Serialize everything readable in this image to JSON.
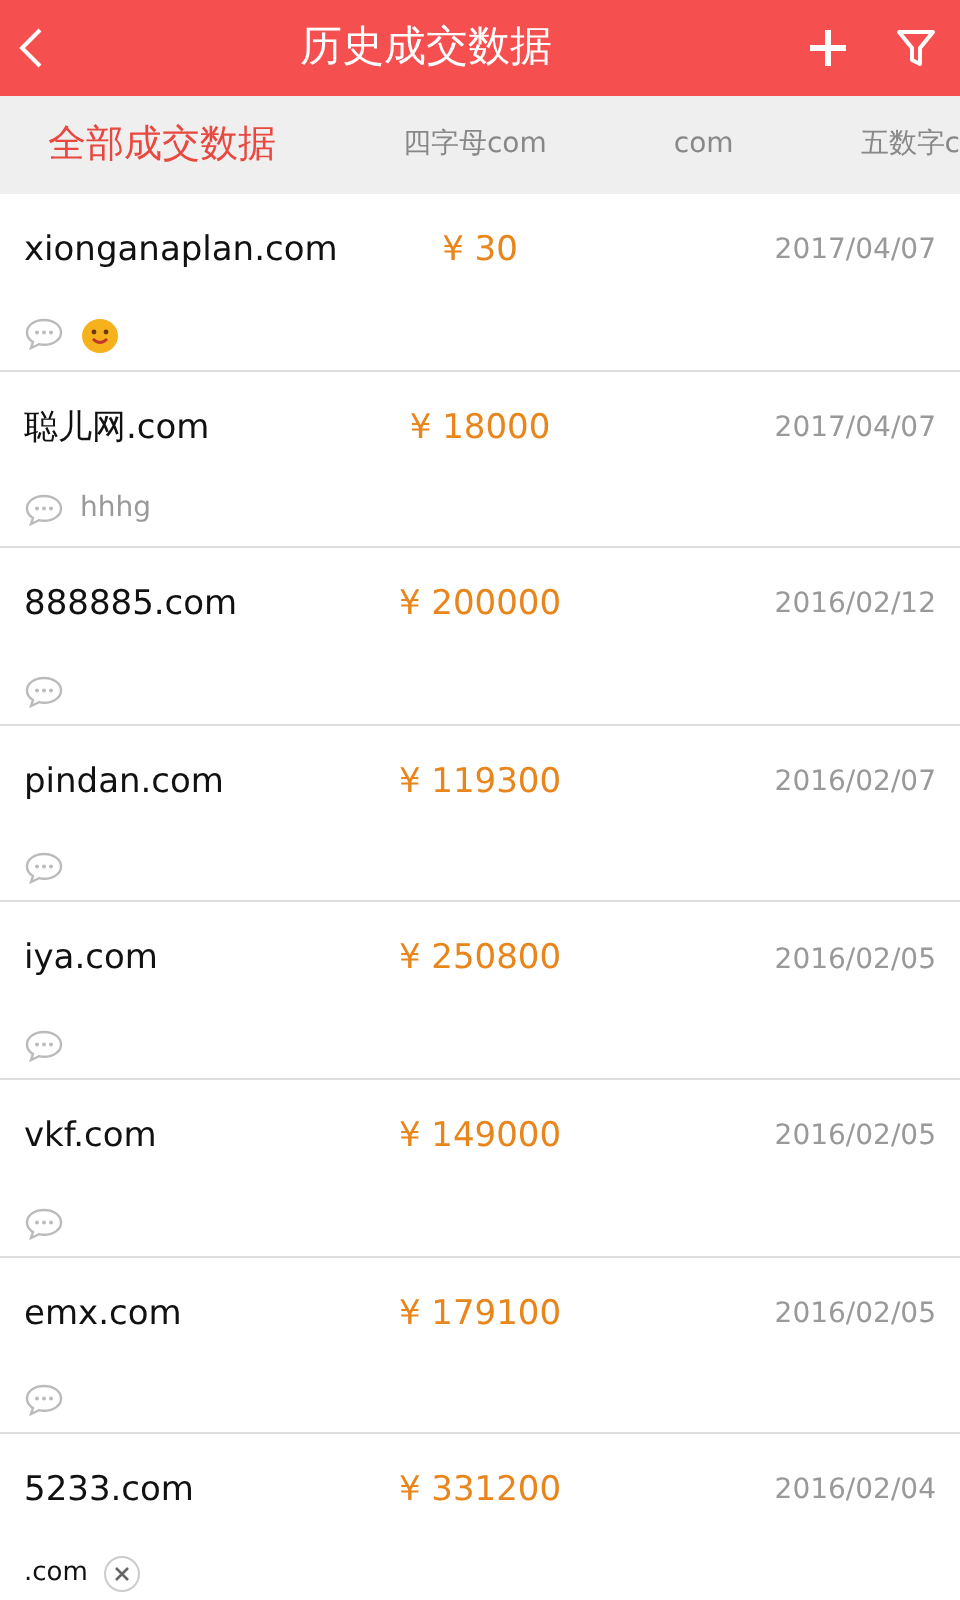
{
  "header": {
    "title": "历史成交数据"
  },
  "tabs": [
    {
      "label": "全部成交数据",
      "selected": true
    },
    {
      "label": "四字母com",
      "selected": false
    },
    {
      "label": "com",
      "selected": false
    },
    {
      "label": "五数字c",
      "selected": false
    }
  ],
  "records": [
    {
      "domain": "xionganaplan.com",
      "price": "¥ 30",
      "date": "2017/04/07",
      "kind": "emoji"
    },
    {
      "domain": "聪儿网.com",
      "price": "¥ 18000",
      "date": "2017/04/07",
      "kind": "comment",
      "comment": "hhhg"
    },
    {
      "domain": "888885.com",
      "price": "¥ 200000",
      "date": "2016/02/12",
      "kind": "empty"
    },
    {
      "domain": "pindan.com",
      "price": "¥ 119300",
      "date": "2016/02/07",
      "kind": "empty"
    },
    {
      "domain": "iya.com",
      "price": "¥ 250800",
      "date": "2016/02/05",
      "kind": "empty"
    },
    {
      "domain": "vkf.com",
      "price": "¥ 149000",
      "date": "2016/02/05",
      "kind": "empty"
    },
    {
      "domain": "emx.com",
      "price": "¥ 179100",
      "date": "2016/02/05",
      "kind": "empty"
    },
    {
      "domain": "5233.com",
      "price": "¥ 331200",
      "date": "2016/02/04",
      "kind": "tag",
      "tag": ".com"
    }
  ]
}
